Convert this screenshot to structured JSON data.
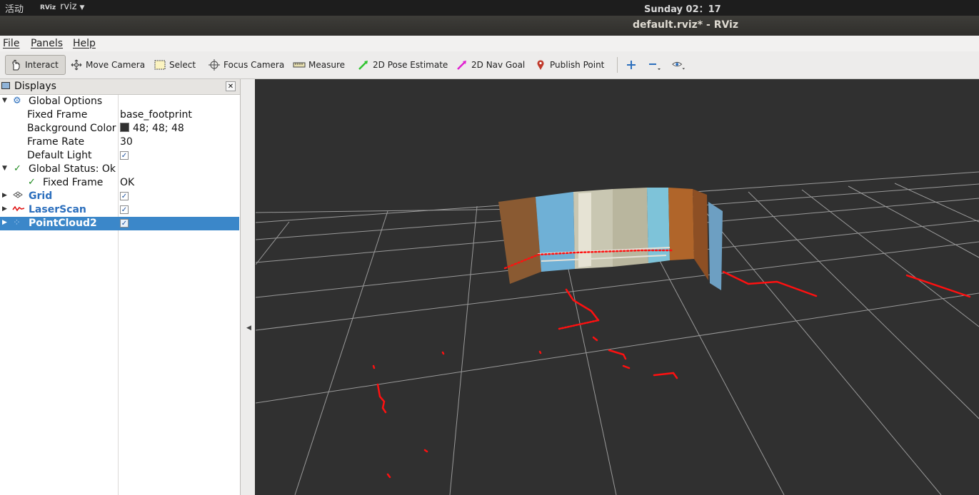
{
  "system_bar": {
    "activities": "活动",
    "app_icon": "RViz",
    "app_name": "rviz",
    "clock": "Sunday 02：17"
  },
  "window": {
    "title": "default.rviz* - RViz"
  },
  "menu": {
    "file": "File",
    "panels": "Panels",
    "help": "Help"
  },
  "toolbar": {
    "interact": "Interact",
    "move_camera": "Move Camera",
    "select": "Select",
    "focus_camera": "Focus Camera",
    "measure": "Measure",
    "pose_estimate": "2D Pose Estimate",
    "nav_goal": "2D Nav Goal",
    "publish_point": "Publish Point"
  },
  "displays": {
    "title": "Displays",
    "global_options": "Global Options",
    "fixed_frame_label": "Fixed Frame",
    "fixed_frame_value": "base_footprint",
    "bg_color_label": "Background Color",
    "bg_color_value": "48; 48; 48",
    "frame_rate_label": "Frame Rate",
    "frame_rate_value": "30",
    "default_light_label": "Default Light",
    "global_status": "Global Status: Ok",
    "status_fixed_frame": "Fixed Frame",
    "status_ok": "OK",
    "grid": "Grid",
    "laserscan": "LaserScan",
    "pointcloud2": "PointCloud2"
  },
  "colors": {
    "background": "#303030",
    "grid_line": "#a0a0a0",
    "laser": "#ff1010",
    "selection": "#3b87c9"
  }
}
